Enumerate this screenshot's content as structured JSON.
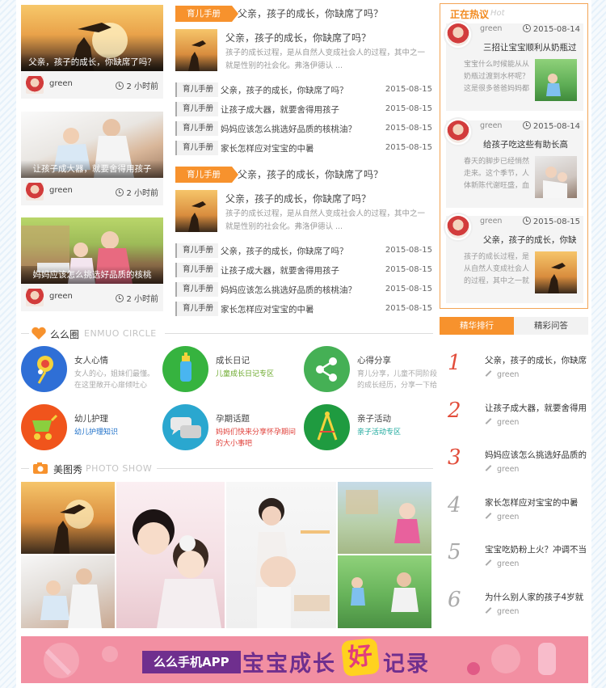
{
  "left_cards": [
    {
      "caption": "父亲，孩子的成长，你缺席了吗？",
      "user": "green",
      "time": "2 小时前"
    },
    {
      "caption": "让孩子成大器，就要舍得用孩子",
      "user": "green",
      "time": "2 小时前"
    },
    {
      "caption": "妈妈应该怎么挑选好品质的核桃",
      "user": "green",
      "time": "2 小时前"
    }
  ],
  "sections": [
    {
      "tag": "育儿手册",
      "title": "父亲，孩子的成长，你缺席了吗？",
      "feature_title": "父亲，孩子的成长，你缺席了吗？",
      "feature_desc": "孩子的成长过程，是从自然人变成社会人的过程，其中之一就是性别的社会化。弗洛伊德认 ...",
      "items": [
        {
          "label": "育儿手册",
          "title": "父亲，孩子的成长，你缺席了吗？",
          "date": "2015-08-15"
        },
        {
          "label": "育儿手册",
          "title": "让孩子成大器，就要舍得用孩子",
          "date": "2015-08-15"
        },
        {
          "label": "育儿手册",
          "title": "妈妈应该怎么挑选好品质的核桃油？",
          "date": "2015-08-15"
        },
        {
          "label": "育儿手册",
          "title": "家长怎样应对宝宝的中暑",
          "date": "2015-08-15"
        }
      ]
    },
    {
      "tag": "育儿手册",
      "title": "父亲，孩子的成长，你缺席了吗？",
      "feature_title": "父亲，孩子的成长，你缺席了吗？",
      "feature_desc": "孩子的成长过程，是从自然人变成社会人的过程，其中之一就是性别的社会化。弗洛伊德认 ...",
      "items": [
        {
          "label": "育儿手册",
          "title": "父亲，孩子的成长，你缺席了吗？",
          "date": "2015-08-15"
        },
        {
          "label": "育儿手册",
          "title": "让孩子成大器，就要舍得用孩子",
          "date": "2015-08-15"
        },
        {
          "label": "育儿手册",
          "title": "妈妈应该怎么挑选好品质的核桃油？",
          "date": "2015-08-15"
        },
        {
          "label": "育儿手册",
          "title": "家长怎样应对宝宝的中暑",
          "date": "2015-08-15"
        }
      ]
    }
  ],
  "hot": {
    "title": "正在热议",
    "title_en": "Hot",
    "items": [
      {
        "user": "green",
        "date": "2015-08-14",
        "title": "三招让宝宝顺利从奶瓶过",
        "desc": "宝宝什么时候能从从奶瓶过渡到水杯呢？这是很多爸爸妈妈都"
      },
      {
        "user": "green",
        "date": "2015-08-14",
        "title": "给孩子吃这些有助长高",
        "desc": "春天的脚步已经悄然走来。这个季节，人体新陈代谢旺盛，血"
      },
      {
        "user": "green",
        "date": "2015-08-15",
        "title": "父亲，孩子的成长，你缺",
        "desc": "孩子的成长过程，是从自然人变成社会人的过程，其中之一就"
      }
    ]
  },
  "rank_tabs": {
    "active": "精华排行",
    "other": "精彩问答"
  },
  "ranking": [
    {
      "num": "1",
      "title": "父亲，孩子的成长，你缺席",
      "user": "green"
    },
    {
      "num": "2",
      "title": "让孩子成大器，就要舍得用",
      "user": "green"
    },
    {
      "num": "3",
      "title": "妈妈应该怎么挑选好品质的",
      "user": "green"
    },
    {
      "num": "4",
      "title": "家长怎样应对宝宝的中暑",
      "user": "green"
    },
    {
      "num": "5",
      "title": "宝宝吃奶粉上火？冲调不当",
      "user": "green"
    },
    {
      "num": "6",
      "title": "为什么别人家的孩子4岁就",
      "user": "green"
    }
  ],
  "circle": {
    "name": "么么圈",
    "name_en": "ENMUO CIRCLE",
    "items": [
      {
        "name": "女人心情",
        "desc": "女人的心，姐妹们最懂。在这里敞开心扉倾吐心",
        "icon": "lollipop-icon",
        "color": "#2f6fd6"
      },
      {
        "name": "成长日记",
        "desc": "儿童成长日记专区",
        "icon": "baby-bottle-icon",
        "color": "#36b33f"
      },
      {
        "name": "心得分享",
        "desc": "育儿分享，儿童不同阶段的成长经历，分享一下给",
        "icon": "share-icon",
        "color": "#45b055"
      },
      {
        "name": "幼儿护理",
        "desc": "幼儿护理知识",
        "icon": "stroller-icon",
        "color": "#f0541c"
      },
      {
        "name": "孕期话题",
        "desc": "妈妈们快来分享怀孕期间的大小事吧",
        "icon": "chat-icon",
        "color": "#2aa7cf"
      },
      {
        "name": "亲子活动",
        "desc": "亲子活动专区",
        "icon": "compass-icon",
        "color": "#1f9b40"
      }
    ]
  },
  "photo": {
    "name": "美图秀",
    "name_en": "PHOTO SHOW"
  },
  "banner": {
    "app": "么么手机APP",
    "text1": "宝宝成长",
    "highlight": "好",
    "text2": "记录"
  }
}
